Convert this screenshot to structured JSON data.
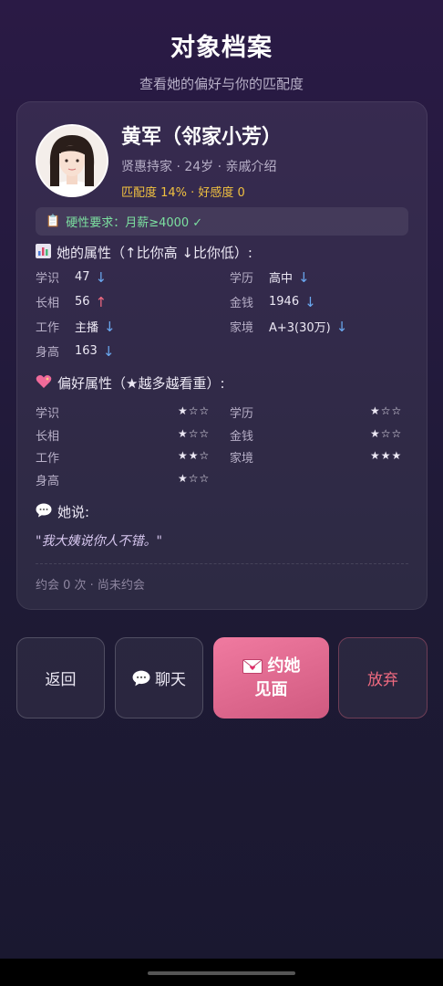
{
  "header": {
    "title": "对象档案",
    "subtitle": "查看她的偏好与你的匹配度"
  },
  "profile": {
    "name": "黄军（邻家小芳）",
    "meta": "贤惠持家 · 24岁 · 亲戚介绍",
    "match": "匹配度 14% · 好感度 0"
  },
  "requirement": {
    "icon": "clipboard-icon",
    "text": "硬性要求：月薪≥4000 ✓"
  },
  "attributes": {
    "title": "她的属性（↑比你高 ↓比你低）:",
    "icon": "bar-chart-icon",
    "items": [
      {
        "key": "学识",
        "value": "47",
        "arrow": "↓"
      },
      {
        "key": "学历",
        "value": "高中",
        "arrow": "↓"
      },
      {
        "key": "长相",
        "value": "56",
        "arrow": "↑"
      },
      {
        "key": "金钱",
        "value": "1946",
        "arrow": "↓"
      },
      {
        "key": "工作",
        "value": "主播",
        "arrow": "↓"
      },
      {
        "key": "家境",
        "value": "A+3(30万)",
        "arrow": "↓"
      },
      {
        "key": "身高",
        "value": "163",
        "arrow": "↓"
      }
    ]
  },
  "preferences": {
    "title": "偏好属性（★越多越看重）:",
    "icon": "sparkling-heart-icon",
    "items": [
      {
        "key": "学识",
        "stars": "★☆☆",
        "level": 1
      },
      {
        "key": "学历",
        "stars": "★☆☆",
        "level": 1
      },
      {
        "key": "长相",
        "stars": "★☆☆",
        "level": 1
      },
      {
        "key": "金钱",
        "stars": "★☆☆",
        "level": 1
      },
      {
        "key": "工作",
        "stars": "★★☆",
        "level": 2
      },
      {
        "key": "家境",
        "stars": "★★★",
        "level": 3
      },
      {
        "key": "身高",
        "stars": "★☆☆",
        "level": 1
      }
    ]
  },
  "says": {
    "title": "她说:",
    "icon": "speech-bubble-icon",
    "quote": "\"我大姨说你人不错。\""
  },
  "dates": "约会 0 次 · 尚未约会",
  "buttons": {
    "back": "返回",
    "chat": "聊天",
    "chat_icon": "speech-bubble-icon",
    "meet_line1": "约她",
    "meet_line2": "见面",
    "meet_icon": "love-letter-icon",
    "give_up": "放弃"
  },
  "colors": {
    "accent_pink": "#e0668c",
    "down_arrow": "#6aa8f0",
    "up_arrow": "#f06a80",
    "match_gold": "#f0c040",
    "requirement_green": "#7ce0a0"
  }
}
